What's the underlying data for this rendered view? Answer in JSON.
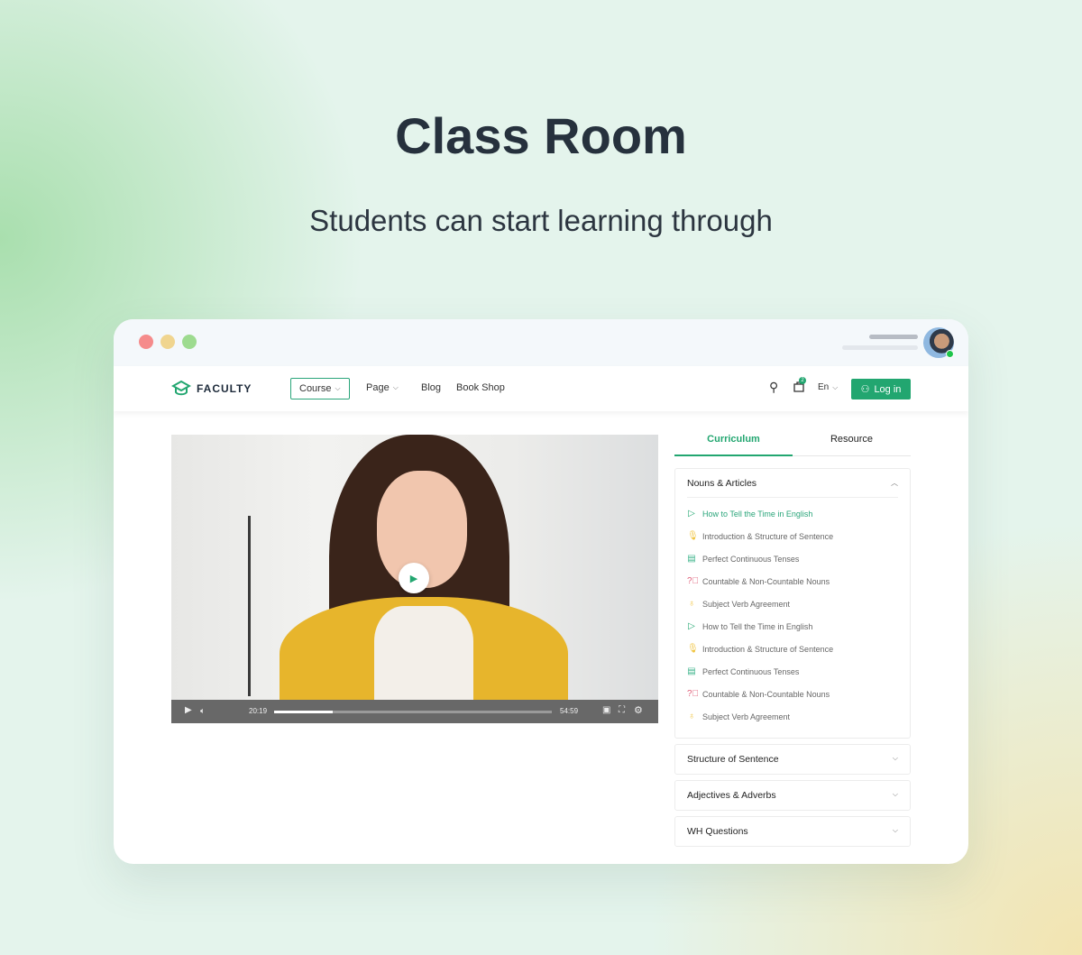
{
  "hero": {
    "title": "Class Room",
    "subtitle": "Students can start learning through"
  },
  "colors": {
    "accent": "#22a670",
    "window_dots": [
      "#f58b8b",
      "#f0d58f",
      "#9ddb8f"
    ]
  },
  "nav": {
    "brand": "FACULTY",
    "items": [
      {
        "label": "Course",
        "dropdown": true
      },
      {
        "label": "Page",
        "dropdown": true
      },
      {
        "label": "Blog"
      },
      {
        "label": "Book Shop"
      }
    ],
    "cart_count": "2",
    "language": "En",
    "login": "Log in"
  },
  "video": {
    "current_time": "20:19",
    "duration": "54:59",
    "progress_percent": 21
  },
  "tabs": [
    {
      "label": "Curriculum",
      "active": true
    },
    {
      "label": "Resource"
    }
  ],
  "sections": [
    {
      "title": "Nouns & Articles",
      "expanded": true,
      "lessons": [
        {
          "icon": "play-icon",
          "title": "How to Tell the Time in English",
          "active": true
        },
        {
          "icon": "microphone-icon",
          "title": "Introduction & Structure of Sentence"
        },
        {
          "icon": "document-icon",
          "title": "Perfect Continuous Tenses"
        },
        {
          "icon": "question-icon",
          "title": "Countable & Non-Countable Nouns"
        },
        {
          "icon": "award-icon",
          "title": "Subject Verb Agreement"
        },
        {
          "icon": "play-icon",
          "title": "How to Tell the Time in English"
        },
        {
          "icon": "microphone-icon",
          "title": "Introduction & Structure of Sentence"
        },
        {
          "icon": "document-icon",
          "title": "Perfect Continuous Tenses"
        },
        {
          "icon": "question-icon",
          "title": "Countable & Non-Countable Nouns"
        },
        {
          "icon": "award-icon",
          "title": "Subject Verb Agreement"
        }
      ]
    },
    {
      "title": "Structure of Sentence",
      "expanded": false
    },
    {
      "title": "Adjectives & Adverbs",
      "expanded": false
    },
    {
      "title": "WH Questions",
      "expanded": false
    }
  ]
}
